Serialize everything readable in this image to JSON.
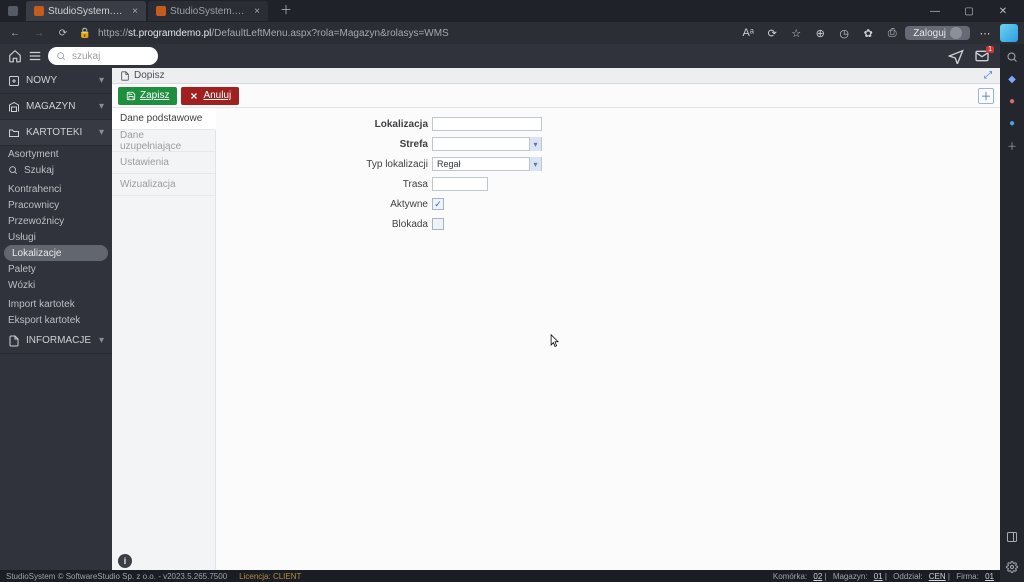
{
  "browser": {
    "tabs": [
      {
        "title": "StudioSystem.NET (c) SoftwareS…"
      },
      {
        "title": "StudioSystem.NET (c) SoftwareS…"
      }
    ],
    "url_host": "st.programdemo.pl",
    "url_path": "/DefaultLeftMenu.aspx?rola=Magazyn&rolasys=WMS",
    "login_label": "Zaloguj"
  },
  "topbar": {
    "search_placeholder": "szukaj"
  },
  "sidenav": {
    "sections": {
      "nowy": "NOWY",
      "magazyn": "MAGAZYN",
      "kartoteki": "KARTOTEKI",
      "informacje": "INFORMACJE"
    },
    "kartoteki_items": {
      "asortyment": "Asortyment",
      "szukaj": "Szukaj",
      "kontrahenci": "Kontrahenci",
      "pracownicy": "Pracownicy",
      "przewoznicy": "Przewoźnicy",
      "uslugi": "Usługi",
      "lokalizacje": "Lokalizacje",
      "palety": "Palety",
      "wozki": "Wózki",
      "import": "Import kartotek",
      "eksport": "Eksport kartotek"
    }
  },
  "content": {
    "header": "Dopisz",
    "buttons": {
      "save": "Zapisz",
      "cancel": "Anuluj"
    },
    "tabs": {
      "dane_podstawowe": "Dane podstawowe",
      "dane_uzup": "Dane uzupełniające",
      "ustawienia": "Ustawienia",
      "wizualizacja": "Wizualizacja"
    },
    "fields": {
      "lokalizacja": "Lokalizacja",
      "strefa": "Strefa",
      "typ": "Typ lokalizacji",
      "typ_value": "Regał",
      "trasa": "Trasa",
      "aktywne": "Aktywne",
      "blokada": "Blokada"
    }
  },
  "footer": {
    "left": "StudioSystem © SoftwareStudio Sp. z o.o. - v2023.5.265.7500",
    "licencja": "Licencja: CLIENT",
    "komorka_l": "Komórka:",
    "komorka_v": "02",
    "magazyn_l": "Magazyn:",
    "magazyn_v": "01",
    "oddzial_l": "Oddział:",
    "oddzial_v": "CEN",
    "firma_l": "Firma:",
    "firma_v": "01"
  }
}
